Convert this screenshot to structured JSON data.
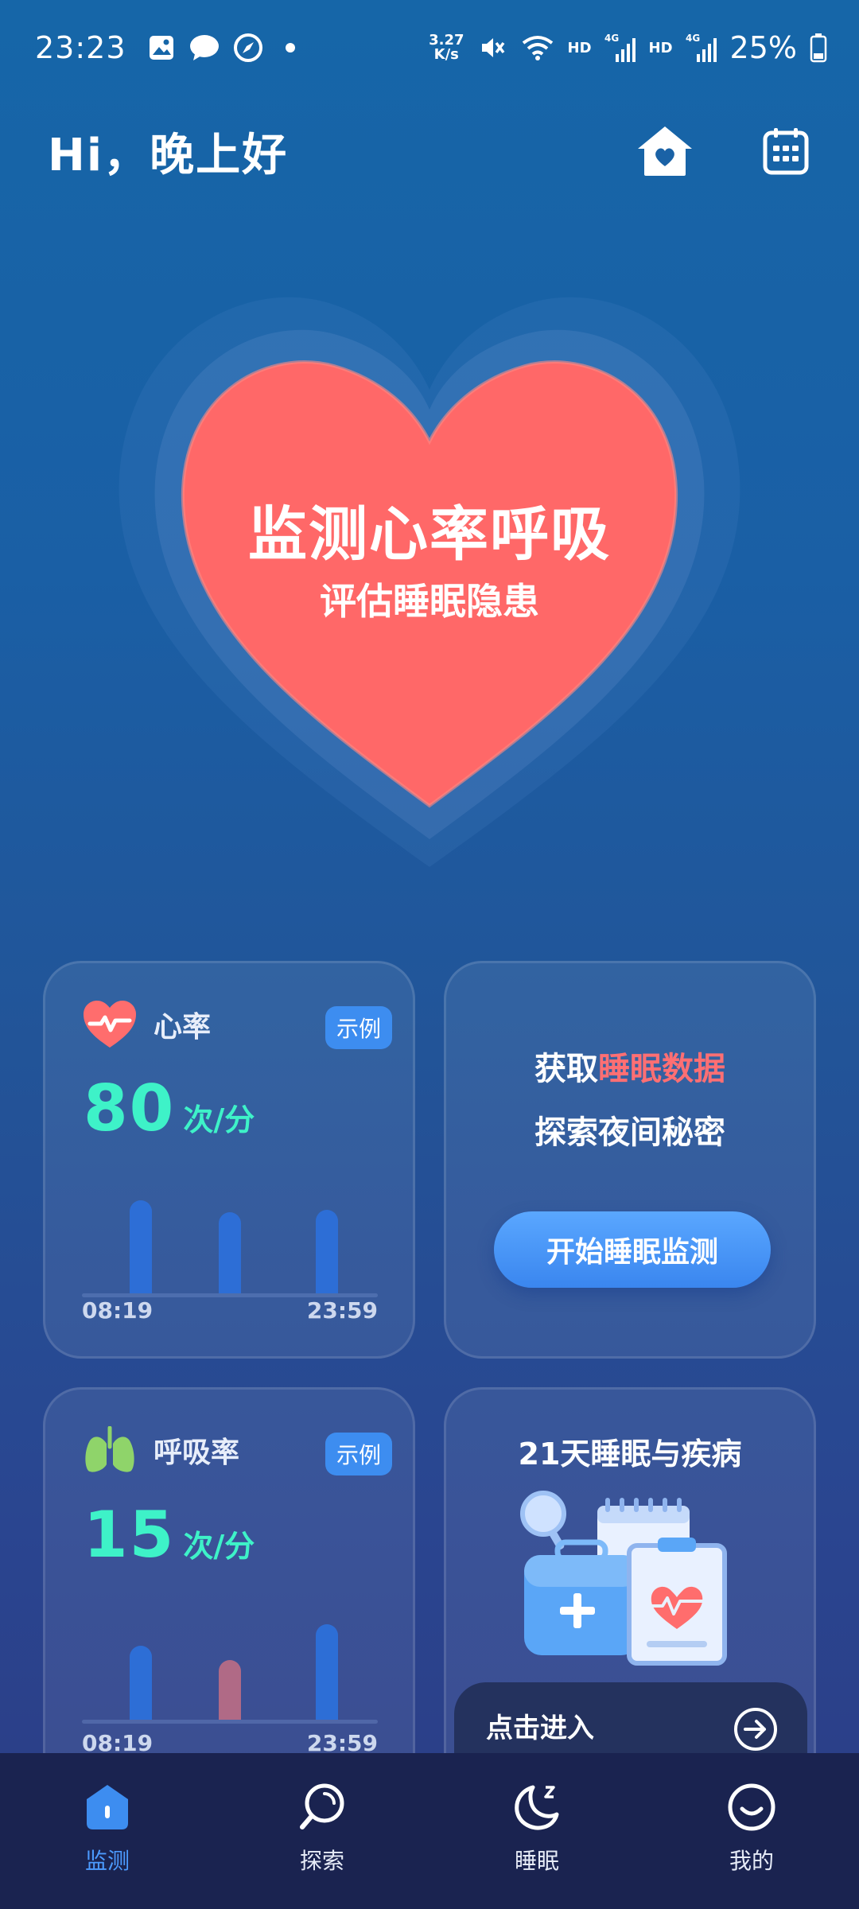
{
  "status_bar": {
    "time": "23:23",
    "net_speed_value": "3.27",
    "net_speed_unit": "K/s",
    "hd1": "HD",
    "hd2": "HD",
    "network1": "4G",
    "network2": "4G",
    "battery": "25%"
  },
  "header": {
    "greeting": "Hi，晚上好"
  },
  "hero": {
    "title": "监测心率呼吸",
    "subtitle": "评估睡眠隐患",
    "heart_color": "#ff6a6a"
  },
  "heart_rate_card": {
    "label": "心率",
    "badge": "示例",
    "value": "80",
    "unit": "次/分",
    "start_time": "08:19",
    "end_time": "23:59",
    "bars": [
      {
        "value": 0.78,
        "color": "#2d6ed6"
      },
      {
        "value": 0.68,
        "color": "#2d6ed6"
      },
      {
        "value": 0.7,
        "color": "#2d6ed6"
      }
    ]
  },
  "sleep_card": {
    "line1_prefix": "获取",
    "line1_highlight": "睡眠数据",
    "line2": "探索夜间秘密",
    "button": "开始睡眠监测"
  },
  "respiration_card": {
    "label": "呼吸率",
    "badge": "示例",
    "value": "15",
    "unit": "次/分",
    "start_time": "08:19",
    "end_time": "23:59",
    "bars": [
      {
        "value": 0.62,
        "color": "#2d6ed6"
      },
      {
        "value": 0.5,
        "color": "#b06a86"
      },
      {
        "value": 0.8,
        "color": "#2d6ed6"
      }
    ]
  },
  "study_card": {
    "title": "21天睡眠与疾病",
    "enter_label": "点击进入"
  },
  "bottom_nav": {
    "items": [
      {
        "label": "监测",
        "icon": "home-shield-icon",
        "active": true
      },
      {
        "label": "探索",
        "icon": "search-icon",
        "active": false
      },
      {
        "label": "睡眠",
        "icon": "moon-icon",
        "active": false
      },
      {
        "label": "我的",
        "icon": "smiley-icon",
        "active": false
      }
    ]
  },
  "colors": {
    "accent_green": "#3ef2c8",
    "accent_blue": "#3d8df0",
    "highlight_red": "#ff6f73"
  }
}
